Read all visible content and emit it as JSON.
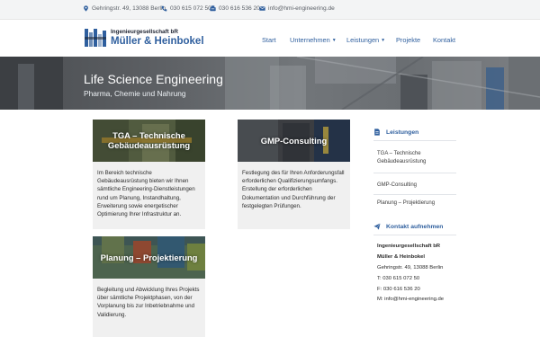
{
  "topbar": {
    "address": "Gehringstr. 49, 13088 Berlin",
    "phone": "030 615 072 50",
    "fax": "030 616 536 20",
    "email": "info@hmi-engineering.de"
  },
  "logo": {
    "line1": "Ingenieurgesellschaft bR",
    "line2": "Müller & Heinbokel"
  },
  "nav": {
    "items": [
      {
        "label": "Start",
        "dropdown": false
      },
      {
        "label": "Unternehmen",
        "dropdown": true
      },
      {
        "label": "Leistungen",
        "dropdown": true
      },
      {
        "label": "Projekte",
        "dropdown": false
      },
      {
        "label": "Kontakt",
        "dropdown": false
      }
    ],
    "chevron": "⌄"
  },
  "hero": {
    "title": "Life Science Engineering",
    "subtitle": "Pharma, Chemie und Nahrung"
  },
  "cards": [
    {
      "title_line1": "TGA – Technische",
      "title_line2": "Gebäudeausrüstung",
      "text": "Im Bereich technische Gebäudeausrüstung bieten wir Ihnen sämtliche Engineering-Dienstleistungen rund um Planung, Instandhaltung, Erweiterung sowie energetischer Optimierung Ihrer Infrastruktur an."
    },
    {
      "title_line1": "GMP-Consulting",
      "title_line2": "",
      "text": "Festlegung des für Ihren Anforderungsfall erforderlichen Qualifizierungsumfangs. Erstellung der erforderlichen Dokumentation und Durchführung der festgelegten Prüfungen."
    },
    {
      "title_line1": "Planung – Projektierung",
      "title_line2": "",
      "text": "Begleitung und Abwicklung Ihres Projekts über sämtliche Projektphasen, von der Vorplanung bis zur Inbetriebnahme und Validierung."
    }
  ],
  "sidebar": {
    "services_heading": "Leistungen",
    "services": [
      "TGA – Technische Gebäudeausrüstung",
      "GMP-Consulting",
      "Planung – Projektierung"
    ],
    "contact_heading": "Kontakt aufnehmen",
    "contact": {
      "company": "Ingenieurgesellschaft bR",
      "name": "Müller & Heinbokel",
      "address": "Gehringstr. 49, 13088 Berlin",
      "phone": "T: 030 615 072 50",
      "fax": "F: 030 616 536 20",
      "email": "M: info@hmi-engineering.de"
    }
  },
  "colors": {
    "brand_blue": "#2f5f9e",
    "topbar_bg": "#f3f4f5",
    "card_bg": "#f0f0f0"
  },
  "icons": {
    "address": "map-pin-icon",
    "phone": "phone-icon",
    "fax": "fax-icon",
    "email": "envelope-icon",
    "services": "document-icon",
    "contact": "paper-plane-icon"
  }
}
